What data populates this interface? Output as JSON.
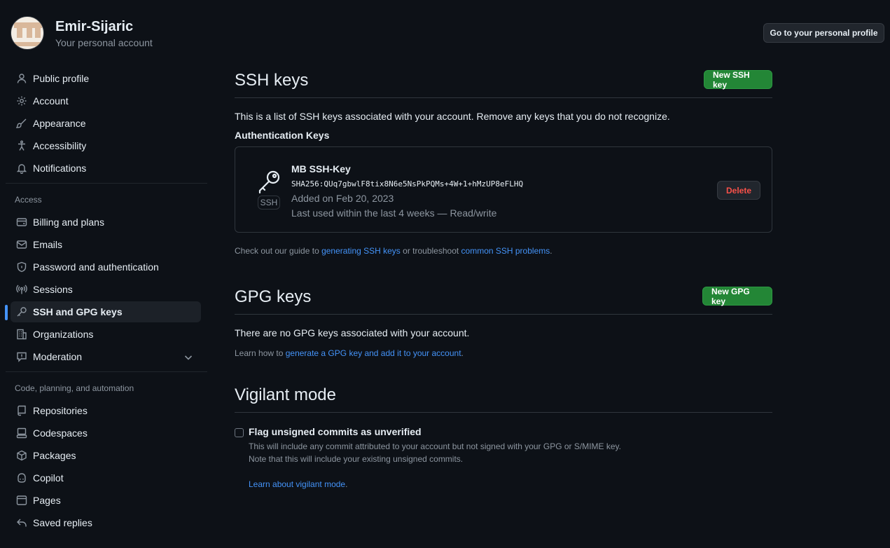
{
  "header": {
    "username": "Emir-Sijaric",
    "subtitle": "Your personal account",
    "profile_button": "Go to your personal profile"
  },
  "sidebar": {
    "items_top": [
      {
        "label": "Public profile",
        "icon": "person-icon"
      },
      {
        "label": "Account",
        "icon": "gear-icon"
      },
      {
        "label": "Appearance",
        "icon": "paintbrush-icon"
      },
      {
        "label": "Accessibility",
        "icon": "accessibility-icon"
      },
      {
        "label": "Notifications",
        "icon": "bell-icon"
      }
    ],
    "access_title": "Access",
    "items_access": [
      {
        "label": "Billing and plans",
        "icon": "credit-card-icon"
      },
      {
        "label": "Emails",
        "icon": "mail-icon"
      },
      {
        "label": "Password and authentication",
        "icon": "shield-lock-icon"
      },
      {
        "label": "Sessions",
        "icon": "broadcast-icon"
      },
      {
        "label": "SSH and GPG keys",
        "icon": "key-icon",
        "active": true
      },
      {
        "label": "Organizations",
        "icon": "organization-icon"
      },
      {
        "label": "Moderation",
        "icon": "report-icon",
        "expandable": true
      }
    ],
    "code_title": "Code, planning, and automation",
    "items_code": [
      {
        "label": "Repositories",
        "icon": "repo-icon"
      },
      {
        "label": "Codespaces",
        "icon": "codespaces-icon"
      },
      {
        "label": "Packages",
        "icon": "package-icon"
      },
      {
        "label": "Copilot",
        "icon": "copilot-icon"
      },
      {
        "label": "Pages",
        "icon": "browser-icon"
      },
      {
        "label": "Saved replies",
        "icon": "reply-icon"
      }
    ]
  },
  "ssh": {
    "title": "SSH keys",
    "new_button": "New SSH key",
    "description": "This is a list of SSH keys associated with your account. Remove any keys that you do not recognize.",
    "auth_title": "Authentication Keys",
    "key": {
      "badge": "SSH",
      "name": "MB SSH-Key",
      "fingerprint": "SHA256:QUq7gbwlF8tix8N6e5NsPkPQMs+4W+1+hMzUP8eFLHQ",
      "added": "Added on Feb 20, 2023",
      "last_used": "Last used within the last 4 weeks — Read/write",
      "delete_label": "Delete"
    },
    "guide_prefix": "Check out our guide to ",
    "guide_link1": "generating SSH keys",
    "guide_mid": " or troubleshoot ",
    "guide_link2": "common SSH problems",
    "guide_suffix": "."
  },
  "gpg": {
    "title": "GPG keys",
    "new_button": "New GPG key",
    "empty": "There are no GPG keys associated with your account.",
    "learn_prefix": "Learn how to ",
    "learn_link": "generate a GPG key and add it to your account",
    "learn_suffix": "."
  },
  "vigilant": {
    "title": "Vigilant mode",
    "checkbox_label": "Flag unsigned commits as unverified",
    "checked": false,
    "desc1": "This will include any commit attributed to your account but not signed with your GPG or S/MIME key.",
    "desc2": "Note that this will include your existing unsigned commits.",
    "learn_link": "Learn about vigilant mode",
    "learn_suffix": "."
  },
  "colors": {
    "background": "#0d1117",
    "accent": "#4493f8",
    "green": "#238636",
    "danger": "#f85149"
  }
}
